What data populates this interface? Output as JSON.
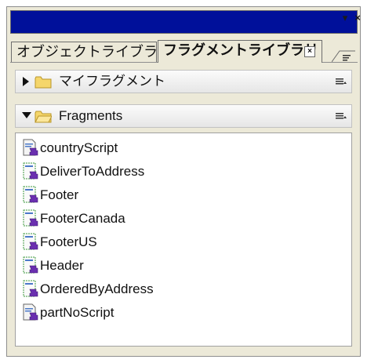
{
  "tabs": [
    {
      "label": "オブジェクトライブラリ",
      "active": false
    },
    {
      "label": "フラグメントライブラリ",
      "active": true,
      "close_glyph": "×"
    }
  ],
  "titlebar": {
    "pin_glyph": "▾",
    "close_glyph": "×"
  },
  "groups": [
    {
      "label": "マイフラグメント",
      "expanded": false
    },
    {
      "label": "Fragments",
      "expanded": true
    }
  ],
  "items": [
    {
      "label": "countryScript",
      "icon": "script-icon"
    },
    {
      "label": "DeliverToAddress",
      "icon": "fragment-icon"
    },
    {
      "label": "Footer",
      "icon": "fragment-icon"
    },
    {
      "label": "FooterCanada",
      "icon": "fragment-icon"
    },
    {
      "label": "FooterUS",
      "icon": "fragment-icon"
    },
    {
      "label": "Header",
      "icon": "fragment-icon"
    },
    {
      "label": "OrderedByAddress",
      "icon": "fragment-icon"
    },
    {
      "label": "partNoScript",
      "icon": "script-icon"
    }
  ],
  "colors": {
    "titlebar": "#00109a",
    "folder": "#f5d66b",
    "puzzle": "#6a2fb0"
  }
}
